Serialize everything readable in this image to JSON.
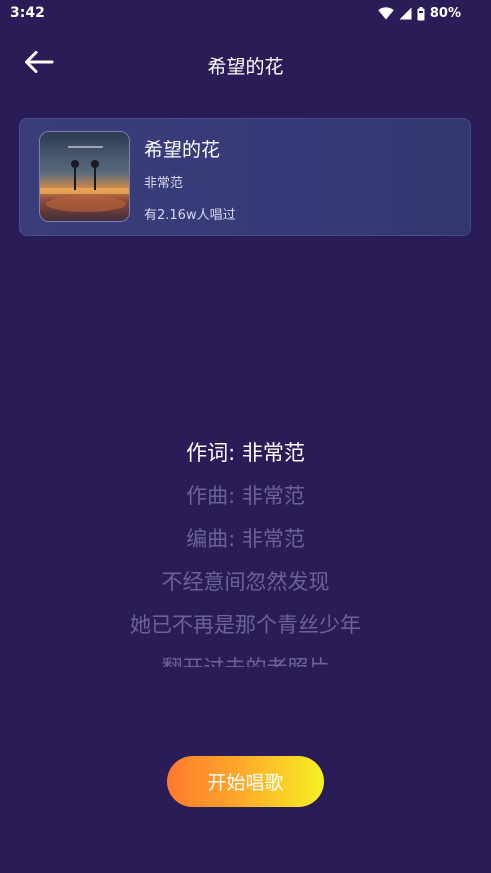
{
  "status_bar": {
    "time": "3:42",
    "battery": "80%",
    "icons": [
      "wifi-icon",
      "cellular-signal-icon",
      "battery-icon"
    ]
  },
  "header": {
    "back_icon": "arrow-left-icon",
    "title": "希望的花"
  },
  "song": {
    "title": "希望的花",
    "artist": "非常范",
    "sing_count": "有2.16w人唱过",
    "cover_icon": "album-cover-image"
  },
  "lyrics": {
    "lines": [
      "作词: 非常范",
      "作曲: 非常范",
      "编曲: 非常范",
      "不经意间忽然发现",
      "她已不再是那个青丝少年",
      "翻开过去的老照片"
    ]
  },
  "start_button": {
    "label": "开始唱歌"
  },
  "colors": {
    "background": "#2a1d57",
    "card": "#3a3d7a",
    "lyric_dim": "#6a6393",
    "button_start": "#ff7a2e",
    "button_end": "#f6f023"
  }
}
